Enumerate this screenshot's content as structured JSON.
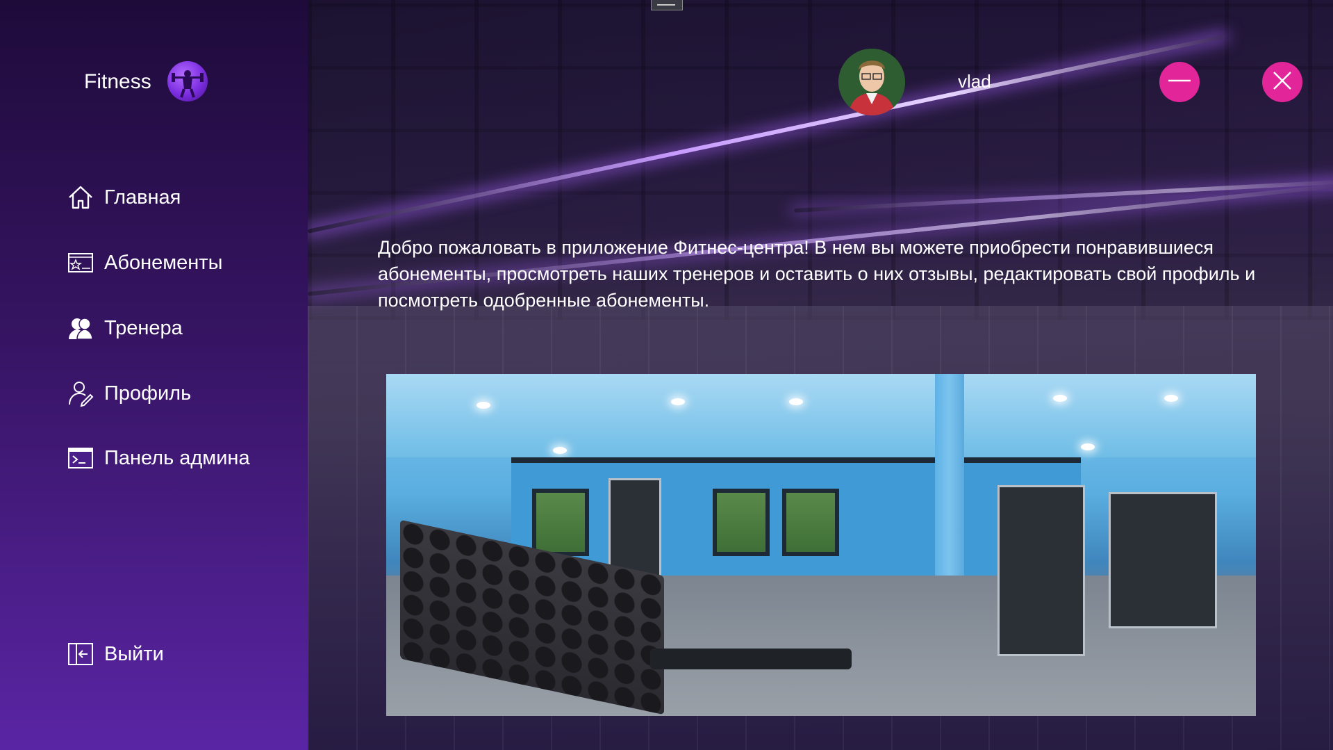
{
  "app": {
    "brand_name": "Fitness",
    "logo_icon": "fitness-logo-icon"
  },
  "sidebar": {
    "items": [
      {
        "label": "Главная",
        "icon": "home-icon"
      },
      {
        "label": "Абонементы",
        "icon": "membership-card-icon"
      },
      {
        "label": "Тренера",
        "icon": "trainers-icon"
      },
      {
        "label": "Профиль",
        "icon": "profile-icon"
      },
      {
        "label": "Панель админа",
        "icon": "admin-terminal-icon"
      }
    ],
    "logout": {
      "label": "Выйти",
      "icon": "logout-icon"
    }
  },
  "header": {
    "username": "vlad",
    "minimize_icon": "minimize-icon",
    "close_icon": "close-icon"
  },
  "main": {
    "welcome_text": "Добро пожаловать в приложение Фитнес-центра! В нем вы можете приобрести понравившиеся абонементы, просмотреть наших тренеров и оставить о них отзывы, редактировать свой профиль и посмотреть одобренные абонементы."
  },
  "colors": {
    "sidebar_top": "#1e0b3a",
    "sidebar_bottom": "#5a25a4",
    "accent_pink": "#e3259a",
    "text": "#ffffff"
  }
}
